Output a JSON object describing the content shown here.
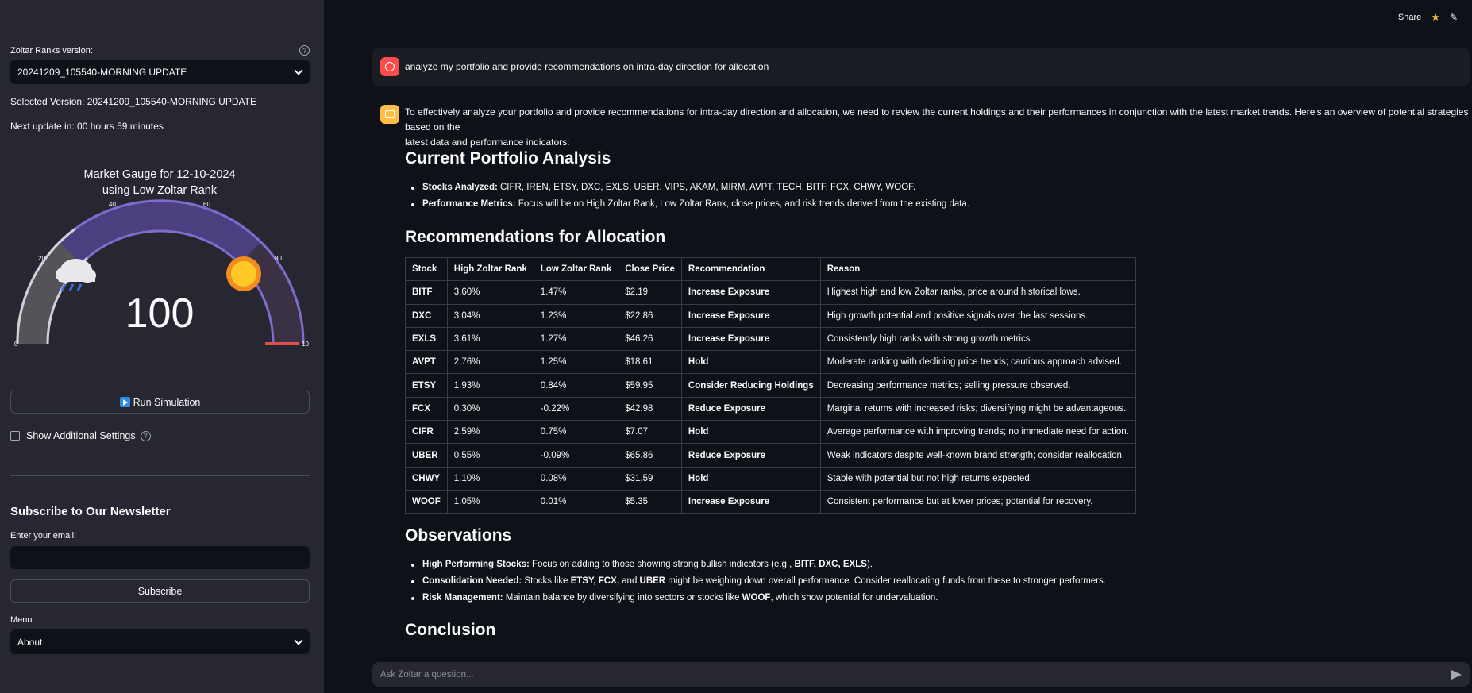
{
  "sidebar": {
    "version_label": "Zoltar Ranks version:",
    "version_select": "20241209_105540-MORNING UPDATE",
    "selected_version": "Selected Version: 20241209_105540-MORNING UPDATE",
    "next_update": "Next update in: 00 hours 59 minutes",
    "gauge": {
      "title_line1": "Market Gauge for 12-10-2024",
      "title_line2": "using Low Zoltar Rank",
      "value": "100",
      "ticks": [
        "0",
        "20",
        "40",
        "60",
        "80",
        "10"
      ]
    },
    "run_button": "Run Simulation",
    "additional_settings": "Show Additional Settings",
    "newsletter_heading": "Subscribe to Our Newsletter",
    "email_label": "Enter your email:",
    "subscribe_button": "Subscribe",
    "menu_label": "Menu",
    "menu_select": "About"
  },
  "header": {
    "share": "Share"
  },
  "chat": {
    "user_message": "analyze my portfolio and provide recommendations on intra-day direction for allocation",
    "intro_line1": "To effectively analyze your portfolio and provide recommendations for intra-day direction and allocation, we need to review the current holdings and their performances in conjunction with the latest market trends. Here's an overview of potential strategies based on the",
    "intro_line2": "latest data and performance indicators:",
    "h_current": "Current Portfolio Analysis",
    "current_items": [
      {
        "label": "Stocks Analyzed:",
        "text": " CIFR, IREN, ETSY, DXC, EXLS, UBER, VIPS, AKAM, MIRM, AVPT, TECH, BITF, FCX, CHWY, WOOF."
      },
      {
        "label": "Performance Metrics:",
        "text": " Focus will be on High Zoltar Rank, Low Zoltar Rank, close prices, and risk trends derived from the existing data."
      }
    ],
    "h_recommendations": "Recommendations for Allocation",
    "table": {
      "headers": [
        "Stock",
        "High Zoltar Rank",
        "Low Zoltar Rank",
        "Close Price",
        "Recommendation",
        "Reason"
      ],
      "rows": [
        [
          "BITF",
          "3.60%",
          "1.47%",
          "$2.19",
          "Increase Exposure",
          "Highest high and low Zoltar ranks, price around historical lows."
        ],
        [
          "DXC",
          "3.04%",
          "1.23%",
          "$22.86",
          "Increase Exposure",
          "High growth potential and positive signals over the last sessions."
        ],
        [
          "EXLS",
          "3.61%",
          "1.27%",
          "$46.26",
          "Increase Exposure",
          "Consistently high ranks with strong growth metrics."
        ],
        [
          "AVPT",
          "2.76%",
          "1.25%",
          "$18.61",
          "Hold",
          "Moderate ranking with declining price trends; cautious approach advised."
        ],
        [
          "ETSY",
          "1.93%",
          "0.84%",
          "$59.95",
          "Consider Reducing Holdings",
          "Decreasing performance metrics; selling pressure observed."
        ],
        [
          "FCX",
          "0.30%",
          "-0.22%",
          "$42.98",
          "Reduce Exposure",
          "Marginal returns with increased risks; diversifying might be advantageous."
        ],
        [
          "CIFR",
          "2.59%",
          "0.75%",
          "$7.07",
          "Hold",
          "Average performance with improving trends; no immediate need for action."
        ],
        [
          "UBER",
          "0.55%",
          "-0.09%",
          "$65.86",
          "Reduce Exposure",
          "Weak indicators despite well-known brand strength; consider reallocation."
        ],
        [
          "CHWY",
          "1.10%",
          "0.08%",
          "$31.59",
          "Hold",
          "Stable with potential but not high returns expected."
        ],
        [
          "WOOF",
          "1.05%",
          "0.01%",
          "$5.35",
          "Increase Exposure",
          "Consistent performance but at lower prices; potential for recovery."
        ]
      ]
    },
    "h_observations": "Observations",
    "obs": {
      "o1_label": "High Performing Stocks:",
      "o1_text": " Focus on adding to those showing strong bullish indicators (e.g., ",
      "o1_b1": "BITF, DXC, EXLS",
      "o1_end": ").",
      "o2_label": "Consolidation Needed:",
      "o2_text1": " Stocks like ",
      "o2_b1": "ETSY, FCX,",
      "o2_text2": " and ",
      "o2_b2": "UBER",
      "o2_text3": " might be weighing down overall performance. Consider reallocating funds from these to stronger performers.",
      "o3_label": "Risk Management:",
      "o3_text": " Maintain balance by diversifying into sectors or stocks like ",
      "o3_b1": "WOOF",
      "o3_end": ", which show potential for undervaluation."
    },
    "h_conclusion": "Conclusion",
    "input_placeholder": "Ask Zoltar a question..."
  },
  "colors": {
    "gauge_arc": "#8e7cc3",
    "gauge_needle_zone": "#e04e4e",
    "accent_red": "#ff4b4b",
    "accent_yellow": "#ffbd45"
  }
}
